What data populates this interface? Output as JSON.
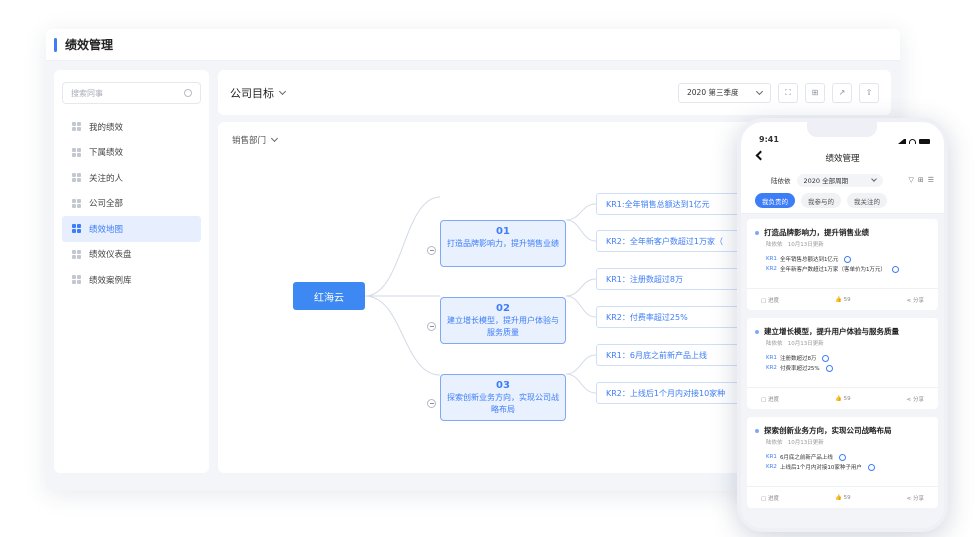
{
  "app": {
    "title": "绩效管理"
  },
  "sidebar": {
    "search_placeholder": "搜索同事",
    "items": [
      {
        "label": "我的绩效"
      },
      {
        "label": "下属绩效"
      },
      {
        "label": "关注的人"
      },
      {
        "label": "公司全部"
      },
      {
        "label": "绩效地图",
        "active": true
      },
      {
        "label": "绩效仪表盘"
      },
      {
        "label": "绩效案例库"
      }
    ]
  },
  "topbar": {
    "goal_label": "公司目标",
    "period": "2020 第三季度"
  },
  "map": {
    "department": "销售部门",
    "root": "红海云",
    "objectives": [
      {
        "num": "01",
        "text": "打造品牌影响力，提升销售业绩",
        "krs": [
          "KR1:全年销售总额达到1亿元",
          "KR2：全年新客户数超过1万家（"
        ]
      },
      {
        "num": "02",
        "text": "建立增长模型，提升用户体验与服务质量",
        "krs": [
          "KR1：注册数超过8万",
          "KR2：付费率超过25%"
        ]
      },
      {
        "num": "03",
        "text": "探索创新业务方向，实现公司战略布局",
        "krs": [
          "KR1：6月底之前新产品上线",
          "KR2：上线后1个月内对接10家种"
        ]
      }
    ]
  },
  "mobile": {
    "time": "9:41",
    "title": "绩效管理",
    "owner": "陆依依",
    "period": "2020 全部周期",
    "tabs": [
      "我负责的",
      "我参与的",
      "我关注的"
    ],
    "cards": [
      {
        "title": "打造品牌影响力，提升销售业绩",
        "owner": "陆依依",
        "updated": "10月13日更新",
        "krs": [
          {
            "tag": "KR1",
            "text": "全年销售总额达到1亿元"
          },
          {
            "tag": "KR2",
            "text": "全年新客户数超过1万家（客单价为1万元）"
          }
        ],
        "progress": "进度",
        "likes": "59",
        "share": "分享"
      },
      {
        "title": "建立增长模型，提升用户体验与服务质量",
        "owner": "陆依依",
        "updated": "10月13日更新",
        "krs": [
          {
            "tag": "KR1",
            "text": "注册数超过8万"
          },
          {
            "tag": "KR2",
            "text": "付费率超过25%"
          }
        ],
        "progress": "进度",
        "likes": "59",
        "share": "分享"
      },
      {
        "title": "探索创新业务方向，实现公司战略布局",
        "owner": "陆依依",
        "updated": "10月13日更新",
        "krs": [
          {
            "tag": "KR1",
            "text": "6月底之前新产品上线"
          },
          {
            "tag": "KR2",
            "text": "上线后1个月内对接10家种子用户"
          }
        ],
        "progress": "进度",
        "likes": "59",
        "share": "分享"
      }
    ]
  },
  "colors": {
    "accent": "#3d7df6",
    "root_node": "#3d88f2",
    "objective_fill": "#e9f1ff"
  }
}
